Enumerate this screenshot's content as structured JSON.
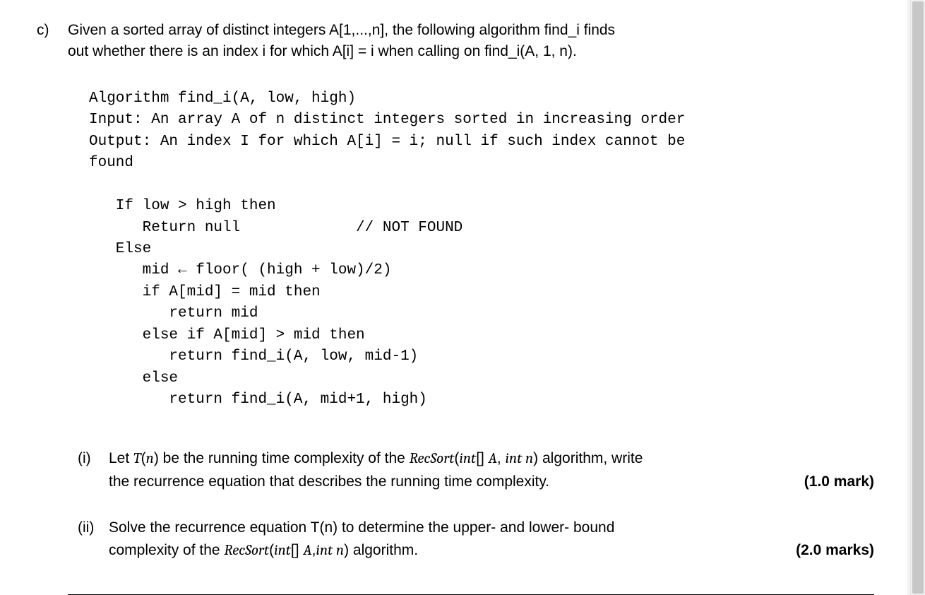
{
  "problem": {
    "label": "c)",
    "prompt_line1": "Given a sorted array of distinct integers A[1,...,n], the following algorithm find_i finds",
    "prompt_line2": "out whether there is an index i for which A[i] = i when calling on find_i(A, 1, n)."
  },
  "code": "Algorithm find_i(A, low, high)\nInput: An array A of n distinct integers sorted in increasing order\nOutput: An index I for which A[i] = i; null if such index cannot be\nfound\n\n   If low > high then\n      Return null             // NOT FOUND\n   Else\n      mid ← floor( (high + low)/2)\n      if A[mid] = mid then\n         return mid\n      else if A[mid] > mid then\n         return find_i(A, low, mid-1)\n      else\n         return find_i(A, mid+1, high)",
  "subparts": {
    "i": {
      "label": "(i)",
      "t1": "Let ",
      "t2": "T",
      "t3": "(",
      "t4": "n",
      "t5": ") be the running time complexity of the ",
      "t6": "RecSort",
      "t7": "(",
      "t8": "int",
      "t9": "[] ",
      "t10": "A",
      "t11": ", ",
      "t12": "int n",
      "t13": ") algorithm, write",
      "line2a": "the recurrence equation that describes the running time complexity.",
      "marks": "(1.0 mark)"
    },
    "ii": {
      "label": "(ii)",
      "line1": "Solve the recurrence equation T(n) to determine the upper- and lower- bound",
      "t1": "complexity of the ",
      "t2": "RecSort",
      "t3": "(",
      "t4": "int",
      "t5": "[] ",
      "t6": "A",
      "t7": ",",
      "t8": "int n",
      "t9": ") algorithm.",
      "marks": "(2.0 marks)"
    }
  }
}
